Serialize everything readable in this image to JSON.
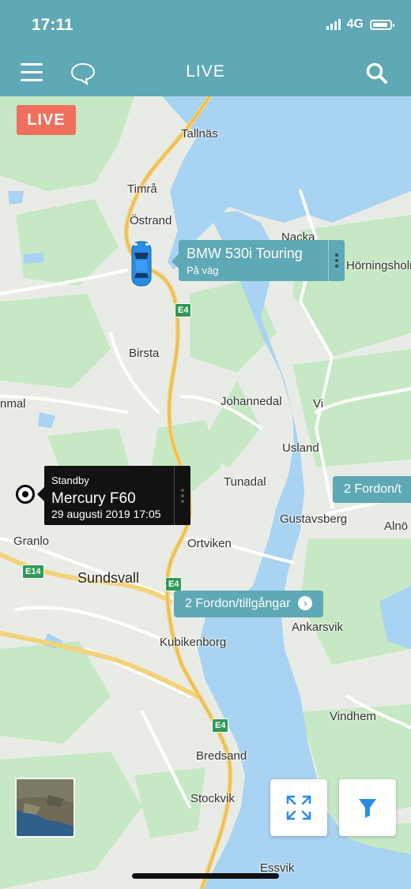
{
  "status_bar": {
    "time": "17:11",
    "network": "4G"
  },
  "nav": {
    "title": "LIVE",
    "menu_icon": "hamburger-menu-icon",
    "chat_icon": "chat-bubble-icon",
    "search_icon": "search-icon"
  },
  "live_badge": "LIVE",
  "towns": [
    "Tallnäs",
    "Timrå",
    "Östrand",
    "Nacka",
    "Hörningsholm",
    "Birsta",
    "Johannedal",
    "Vi",
    "nmal",
    "Usland",
    "Tunadal",
    "Gustavsberg",
    "Alnö",
    "Granlo",
    "Ortviken",
    "Sundsvall",
    "Ankarsvik",
    "Kubikenborg",
    "Vindhem",
    "Bredsand",
    "Stockvik",
    "Essvik"
  ],
  "road_shields": [
    "E4",
    "E4",
    "E4",
    "E14"
  ],
  "vehicle": {
    "name": "BMW 530i Touring",
    "status": "På väg",
    "icon": "car-icon"
  },
  "standby": {
    "status": "Standby",
    "name": "Mercury F60",
    "date": "29 augusti 2019 17:05"
  },
  "clusters": [
    {
      "label": "2 Fordon/tillgångar"
    },
    {
      "label": "2 Fordon/t"
    }
  ],
  "buttons": {
    "fullscreen_icon": "fullscreen-expand-icon",
    "filter_icon": "filter-funnel-icon",
    "map_type_icon": "satellite-map-icon"
  },
  "colors": {
    "header": "#5fa8b5",
    "live_badge": "#f0705e",
    "water": "#a8d3f2",
    "land": "#e9ece6",
    "green": "#c6e8c4",
    "road": "#f4d27a",
    "accent_blue": "#2a8ce6"
  }
}
